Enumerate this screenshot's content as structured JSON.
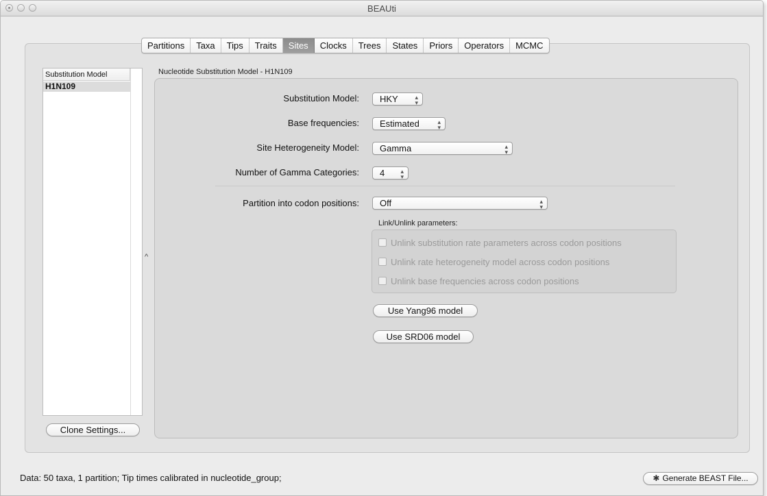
{
  "window": {
    "title": "BEAUti"
  },
  "tabs": [
    {
      "label": "Partitions",
      "active": false
    },
    {
      "label": "Taxa",
      "active": false
    },
    {
      "label": "Tips",
      "active": false
    },
    {
      "label": "Traits",
      "active": false
    },
    {
      "label": "Sites",
      "active": true
    },
    {
      "label": "Clocks",
      "active": false
    },
    {
      "label": "Trees",
      "active": false
    },
    {
      "label": "States",
      "active": false
    },
    {
      "label": "Priors",
      "active": false
    },
    {
      "label": "Operators",
      "active": false
    },
    {
      "label": "MCMC",
      "active": false
    }
  ],
  "left_panel": {
    "header": "Substitution Model",
    "rows": [
      "H1N109"
    ],
    "clone_button": "Clone Settings...",
    "splitter_glyph": "^"
  },
  "model_panel": {
    "title": "Nucleotide Substitution Model - H1N109",
    "fields": {
      "substitution_model": {
        "label": "Substitution Model:",
        "value": "HKY"
      },
      "base_frequencies": {
        "label": "Base frequencies:",
        "value": "Estimated"
      },
      "site_heterogeneity": {
        "label": "Site Heterogeneity Model:",
        "value": "Gamma"
      },
      "gamma_categories": {
        "label": "Number of Gamma Categories:",
        "value": "4"
      },
      "codon_partition": {
        "label": "Partition into codon positions:",
        "value": "Off"
      }
    },
    "link_group": {
      "label": "Link/Unlink parameters:",
      "checkboxes": [
        {
          "label": "Unlink substitution rate parameters across codon positions",
          "checked": false
        },
        {
          "label": "Unlink rate heterogeneity model across codon positions",
          "checked": false
        },
        {
          "label": "Unlink base frequencies across codon positions",
          "checked": false
        }
      ]
    },
    "yang96_button": "Use Yang96 model",
    "srd06_button": "Use SRD06 model"
  },
  "status_bar": {
    "text": "Data: 50 taxa, 1 partition; Tip times calibrated in nucleotide_group;",
    "generate_button": "Generate BEAST File..."
  },
  "icons": {
    "close": "close-icon",
    "gear": "gear-icon"
  }
}
